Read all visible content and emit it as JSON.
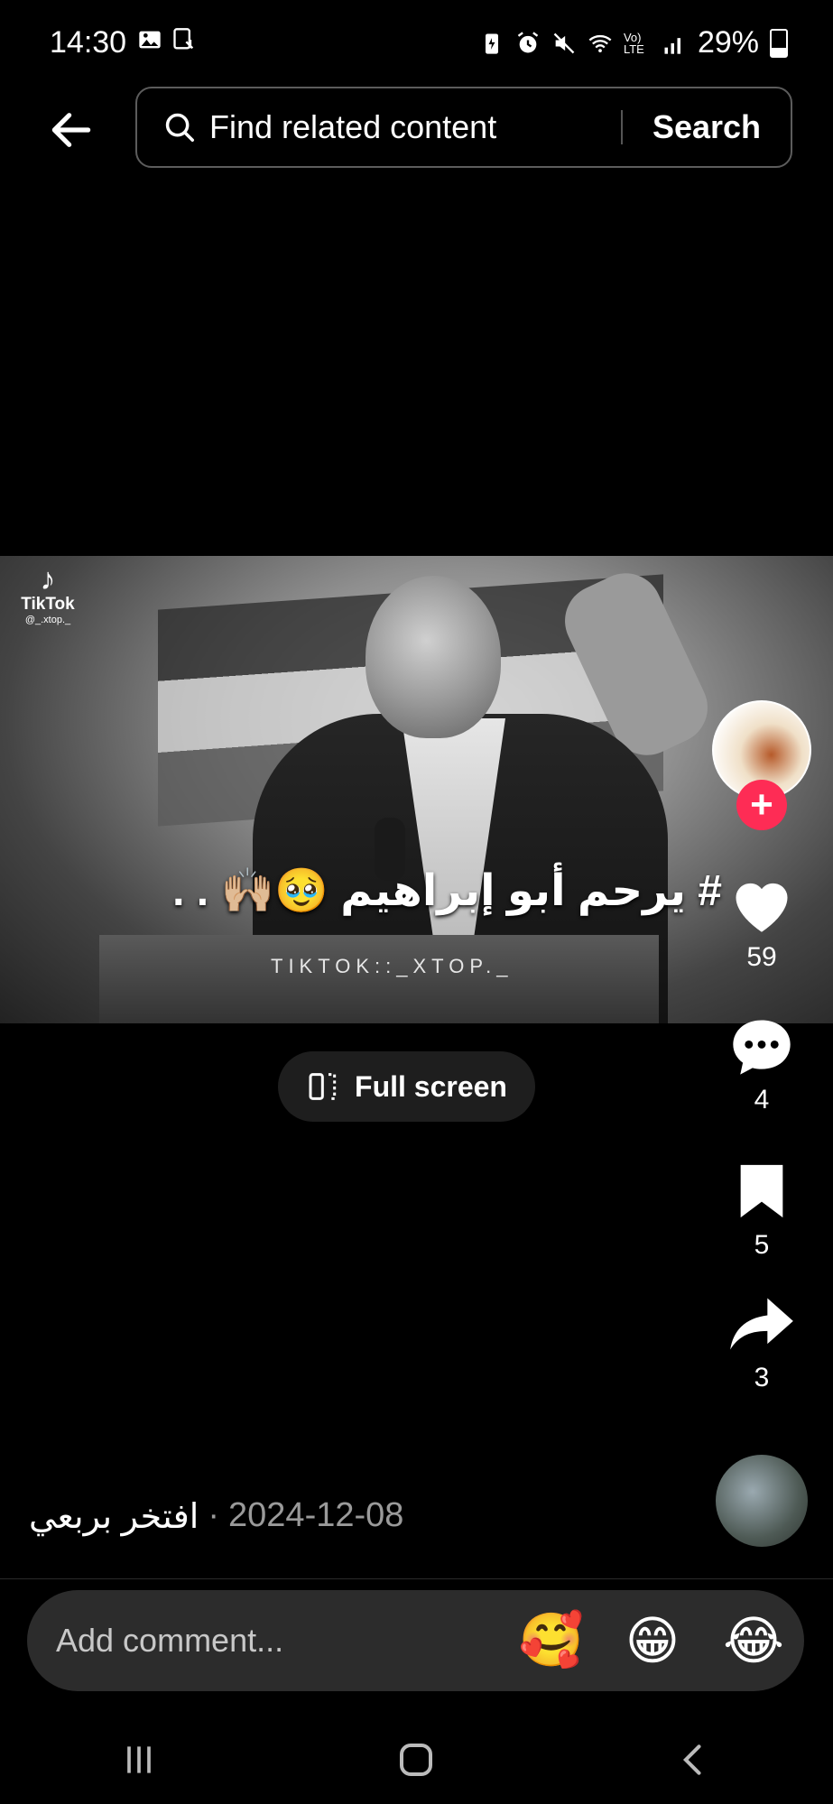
{
  "status_bar": {
    "time": "14:30",
    "network": "Vo) LTE",
    "battery": "29%",
    "left_icons": [
      "gallery-icon",
      "screenshot-icon"
    ],
    "right_icons": [
      "battery-saver-icon",
      "alarm-icon",
      "mute-icon",
      "wifi-icon",
      "signal-icon"
    ]
  },
  "header": {
    "search_placeholder": "Find related content",
    "search_button": "Search"
  },
  "video": {
    "watermark_brand": "TikTok",
    "watermark_user": "@_.xtop._",
    "caption": "# يرحم أبو إبراهيم 🥹🙌🏼 . .",
    "overlay_text": "TIKTOK::_XTOP._"
  },
  "fullscreen_button": "Full screen",
  "actions": {
    "likes": "59",
    "comments": "4",
    "saves": "5",
    "shares": "3"
  },
  "post": {
    "author": "افتخر بربعي",
    "separator": "·",
    "date": "2024-12-08"
  },
  "comment_bar": {
    "placeholder": "Add comment...",
    "emojis": [
      "🥰",
      "😁",
      "😂"
    ]
  },
  "colors": {
    "background": "#000000",
    "follow_accent": "#fe2c55",
    "comment_bar_bg": "#2c2c2c"
  }
}
